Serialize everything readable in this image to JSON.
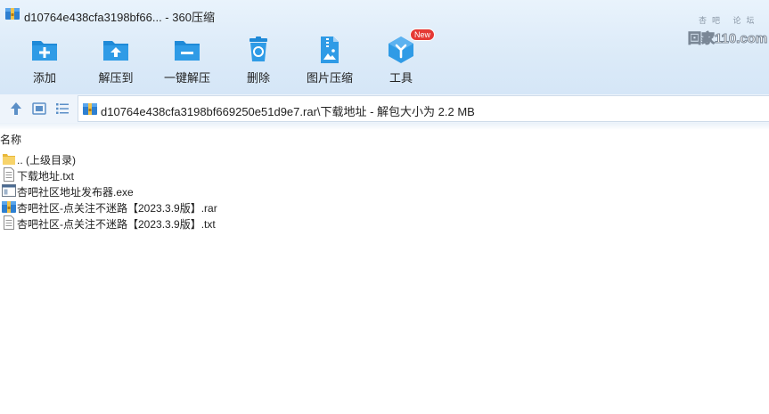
{
  "window": {
    "title": "d10764e438cfa3198bf66... - 360压缩"
  },
  "watermark": {
    "top_text": "杏吧 论坛",
    "main_text": "回家110.com"
  },
  "toolbar": {
    "items": [
      {
        "label": "添加",
        "icon": "add-icon"
      },
      {
        "label": "解压到",
        "icon": "extract-to-icon"
      },
      {
        "label": "一键解压",
        "icon": "one-click-extract-icon"
      },
      {
        "label": "删除",
        "icon": "delete-icon"
      },
      {
        "label": "图片压缩",
        "icon": "image-compress-icon"
      },
      {
        "label": "工具",
        "icon": "tools-icon",
        "badge": "New"
      }
    ]
  },
  "address": {
    "path": "d10764e438cfa3198bf669250e51d9e7.rar\\下载地址 - 解包大小为 2.2 MB"
  },
  "columns": {
    "name": "名称"
  },
  "files": [
    {
      "name": ".. (上级目录)",
      "icon": "folder-icon"
    },
    {
      "name": "下载地址.txt",
      "icon": "text-file-icon"
    },
    {
      "name": "杏吧社区地址发布器.exe",
      "icon": "exe-file-icon"
    },
    {
      "name": "杏吧社区-点关注不迷路【2023.3.9版】.rar",
      "icon": "rar-file-icon"
    },
    {
      "name": "杏吧社区-点关注不迷路【2023.3.9版】.txt",
      "icon": "text-file-icon"
    }
  ],
  "colors": {
    "accent_blue": "#1f8ad8",
    "badge_red": "#e53935"
  }
}
